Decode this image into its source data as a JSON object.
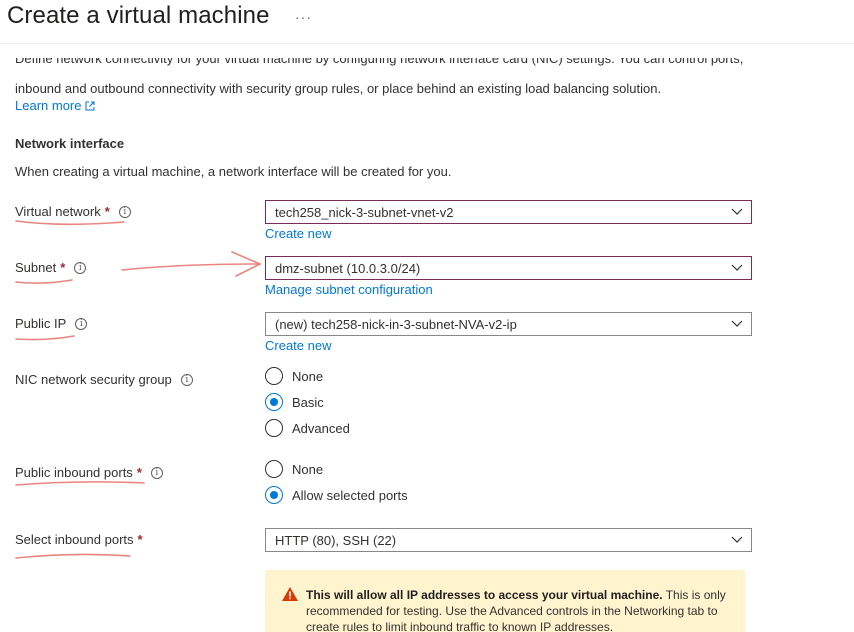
{
  "header": {
    "title": "Create a virtual machine",
    "more": "···"
  },
  "intro": {
    "clipped_line": "Define network connectivity for your virtual machine by configuring network interface card (NIC) settings. You can control ports,",
    "line2": "inbound and outbound connectivity with security group rules, or place behind an existing load balancing solution.",
    "learn_more": "Learn more"
  },
  "section": {
    "title": "Network interface",
    "description": "When creating a virtual machine, a network interface will be created for you."
  },
  "fields": {
    "virtual_network": {
      "label": "Virtual network",
      "required": "*",
      "value": "tech258_nick-3-subnet-vnet-v2",
      "link": "Create new"
    },
    "subnet": {
      "label": "Subnet",
      "required": "*",
      "value": "dmz-subnet (10.0.3.0/24)",
      "link": "Manage subnet configuration"
    },
    "public_ip": {
      "label": "Public IP",
      "value": "(new) tech258-nick-in-3-subnet-NVA-v2-ip",
      "link": "Create new"
    },
    "nic_nsg": {
      "label": "NIC network security group",
      "options": [
        "None",
        "Basic",
        "Advanced"
      ],
      "selected": "Basic"
    },
    "public_inbound_ports": {
      "label": "Public inbound ports",
      "required": "*",
      "options": [
        "None",
        "Allow selected ports"
      ],
      "selected": "Allow selected ports"
    },
    "select_inbound_ports": {
      "label": "Select inbound ports",
      "required": "*",
      "value": "HTTP (80), SSH (22)"
    }
  },
  "warning": {
    "bold": "This will allow all IP addresses to access your virtual machine.",
    "text": " This is only recommended for testing.  Use the Advanced controls in the Networking tab to create rules to limit inbound traffic to known IP addresses."
  },
  "colors": {
    "accent": "#0078d4",
    "required": "#a4262c",
    "active_border": "#7a2b5a",
    "annotation": "#e8857f",
    "warning_bg": "#fff4ce"
  }
}
